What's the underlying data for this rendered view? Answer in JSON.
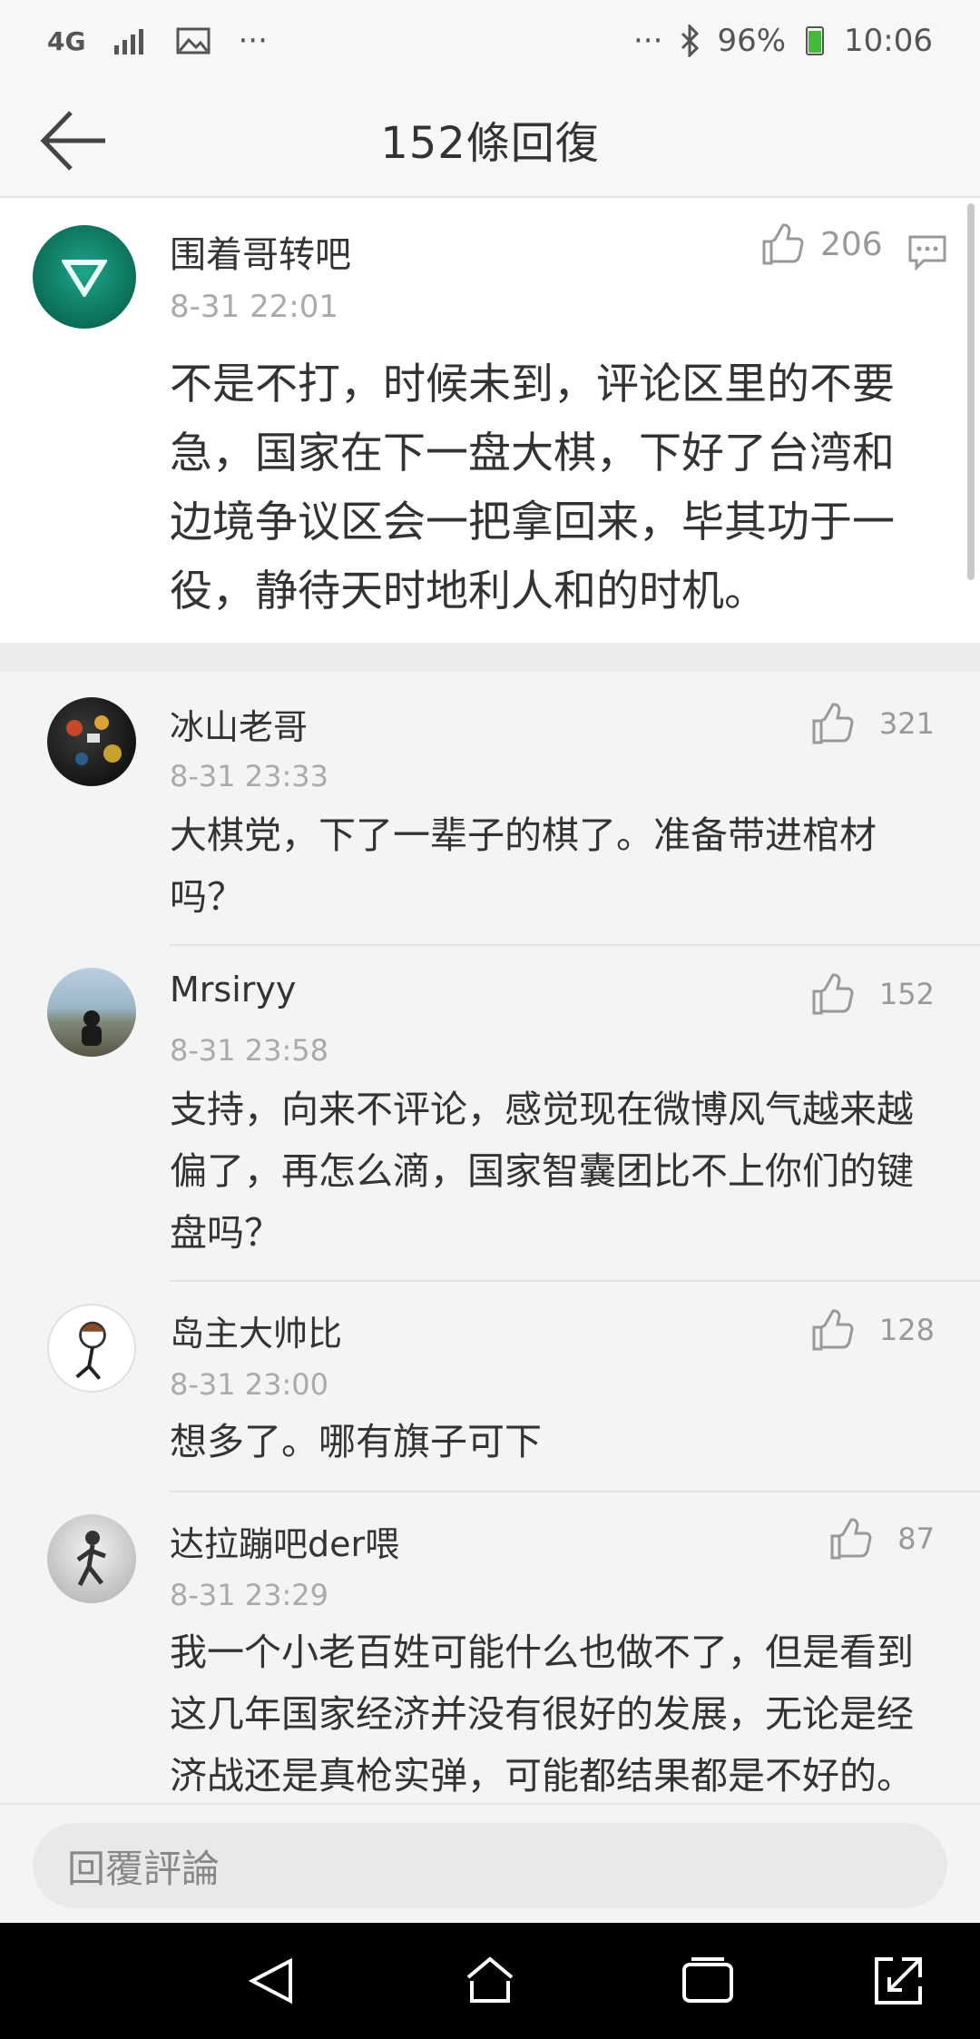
{
  "status": {
    "network": "4G",
    "more_left": "···",
    "more_right": "···",
    "battery": "96%",
    "time": "10:06"
  },
  "header": {
    "title": "152條回復"
  },
  "main_comment": {
    "user": "围着哥转吧",
    "time": "8-31 22:01",
    "likes": "206",
    "text": "不是不打，时候未到，评论区里的不要急，国家在下一盘大棋，下好了台湾和边境争议区会一把拿回来，毕其功于一役，静待天时地利人和的时机。"
  },
  "comments": [
    {
      "user": "冰山老哥",
      "time": "8-31 23:33",
      "likes": "321",
      "text": "大棋党，下了一辈子的棋了。准备带进棺材吗？"
    },
    {
      "user": "Mrsiryy",
      "time": "8-31 23:58",
      "likes": "152",
      "text": "支持，向来不评论，感觉现在微博风气越来越偏了，再怎么滴，国家智囊团比不上你们的键盘吗？"
    },
    {
      "user": "岛主大帅比",
      "time": "8-31 23:00",
      "likes": "128",
      "text": "想多了。哪有旗子可下"
    },
    {
      "user": "达拉蹦吧der喂",
      "time": "8-31 23:29",
      "likes": "87",
      "text": "我一个小老百姓可能什么也做不了，但是看到这几年国家经济并没有很好的发展，无论是经济战还是真枪实弹，可能都结果都是不好的。"
    }
  ],
  "reply_bar": {
    "placeholder": "回覆評論"
  },
  "icons": {
    "back": "arrow-left-icon",
    "like": "thumbs-up-icon",
    "reply": "comment-icon",
    "nav_back": "triangle-back-icon",
    "nav_home": "home-icon",
    "nav_recent": "recent-apps-icon",
    "nav_expand": "expand-icon"
  }
}
